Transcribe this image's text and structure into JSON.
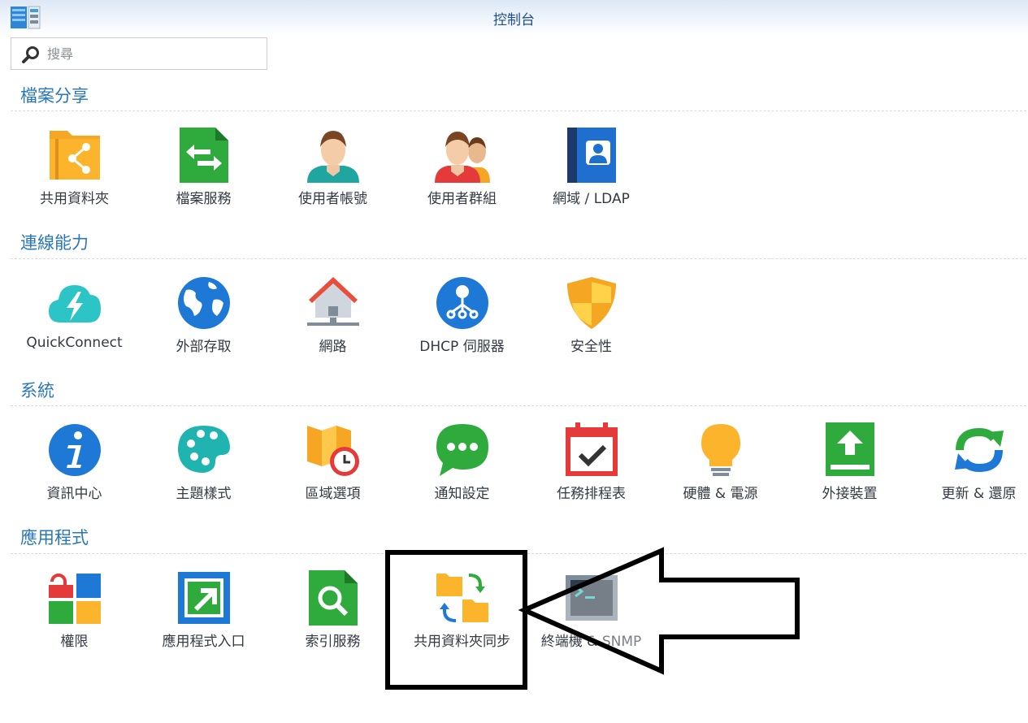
{
  "window": {
    "title": "控制台"
  },
  "search": {
    "placeholder": "搜尋",
    "value": ""
  },
  "sections": [
    {
      "title": "檔案分享",
      "items": [
        {
          "label": "共用資料夾",
          "icon": "shared-folder-icon"
        },
        {
          "label": "檔案服務",
          "icon": "file-services-icon"
        },
        {
          "label": "使用者帳號",
          "icon": "user-icon"
        },
        {
          "label": "使用者群組",
          "icon": "group-icon"
        },
        {
          "label": "網域 / LDAP",
          "icon": "domain-ldap-icon"
        }
      ]
    },
    {
      "title": "連線能力",
      "items": [
        {
          "label": "QuickConnect",
          "icon": "quickconnect-icon"
        },
        {
          "label": "外部存取",
          "icon": "globe-icon"
        },
        {
          "label": "網路",
          "icon": "network-house-icon"
        },
        {
          "label": "DHCP 伺服器",
          "icon": "dhcp-icon"
        },
        {
          "label": "安全性",
          "icon": "shield-icon"
        }
      ]
    },
    {
      "title": "系統",
      "items": [
        {
          "label": "資訊中心",
          "icon": "info-icon"
        },
        {
          "label": "主題樣式",
          "icon": "palette-icon"
        },
        {
          "label": "區域選項",
          "icon": "map-clock-icon"
        },
        {
          "label": "通知設定",
          "icon": "chat-bubble-icon"
        },
        {
          "label": "任務排程表",
          "icon": "calendar-check-icon"
        },
        {
          "label": "硬體 & 電源",
          "icon": "lightbulb-icon"
        },
        {
          "label": "外接裝置",
          "icon": "upload-drive-icon"
        },
        {
          "label": "更新 & 還原",
          "icon": "refresh-icon"
        }
      ]
    },
    {
      "title": "應用程式",
      "items": [
        {
          "label": "權限",
          "icon": "privileges-icon"
        },
        {
          "label": "應用程式入口",
          "icon": "app-portal-icon"
        },
        {
          "label": "索引服務",
          "icon": "indexing-icon"
        },
        {
          "label": "共用資料夾同步",
          "icon": "folder-sync-icon"
        },
        {
          "label": "終端機 & SNMP",
          "icon": "terminal-icon"
        }
      ]
    }
  ],
  "colors": {
    "section_title": "#2a77b8",
    "annotation": "#000000"
  }
}
